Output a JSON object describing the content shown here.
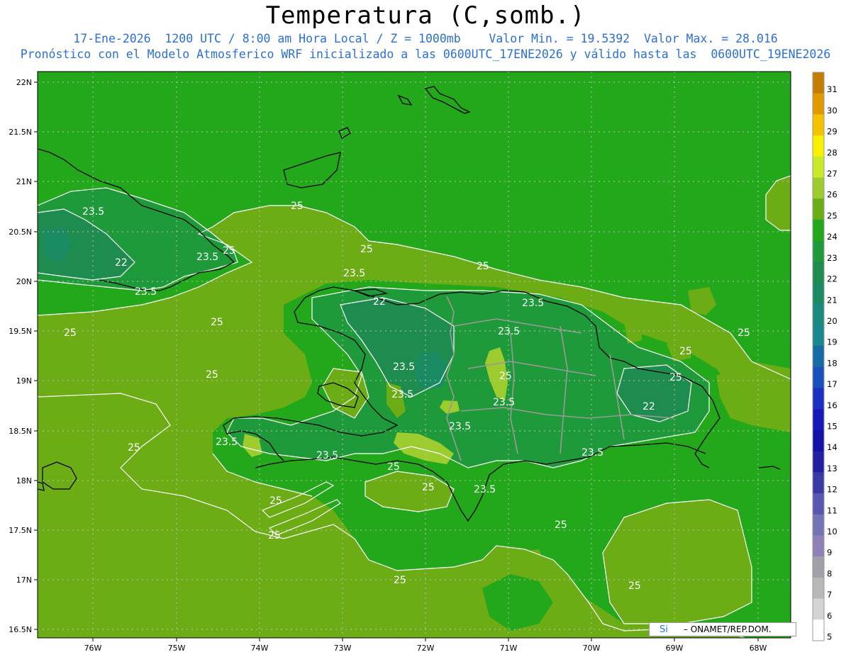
{
  "title": "Temperatura (C,somb.)",
  "subtitle_line1": "17-Ene-2026  1200 UTC / 8:00 am Hora Local / Z = 1000mb    Valor Min. = 19.5392  Valor Max. = 28.016",
  "subtitle_line2": "Pronóstico con el Modelo Atmosferico WRF inicializado a las 0600UTC_17ENE2026 y válido hasta las  0600UTC_19ENE2026",
  "lat_labels": [
    "22N",
    "21.5N",
    "21N",
    "20.5N",
    "20N",
    "19.5N",
    "19N",
    "18.5N",
    "18N",
    "17.5N",
    "17N",
    "16.5N"
  ],
  "lon_labels": [
    "76W",
    "75W",
    "74W",
    "73W",
    "72W",
    "71W",
    "70W",
    "69W",
    "68W"
  ],
  "colorbar": {
    "levels": [
      "31",
      "30",
      "29",
      "28",
      "27",
      "26",
      "25",
      "24",
      "23",
      "22",
      "21",
      "20",
      "19",
      "18",
      "17",
      "16",
      "15",
      "14",
      "13",
      "12",
      "11",
      "10",
      "9",
      "8",
      "7",
      "6",
      "5"
    ],
    "colors": [
      "#c47d00",
      "#e09a00",
      "#f5c200",
      "#f7f000",
      "#c8ea2a",
      "#9ccc2e",
      "#6cad15",
      "#22a81a",
      "#1f9a3a",
      "#1d8c4e",
      "#1a8a62",
      "#188a80",
      "#17888f",
      "#166aa6",
      "#1a50bb",
      "#1a30c2",
      "#1818b8",
      "#1212a8",
      "#2020a0",
      "#3a3aa6",
      "#5858b0",
      "#7474b4",
      "#9080b8",
      "#a0a0a8",
      "#b8b8b8",
      "#d4d4d4",
      "#ffffff"
    ]
  },
  "colors": {
    "sea": "#6cad15",
    "land_24": "#22a81a",
    "land_23": "#1f9a3a",
    "land_22": "#1d8c4e",
    "land_warm": "#9ccc2e",
    "highland_cold": "#1a8a62"
  },
  "contour_labels": [
    {
      "text": "25"
    },
    {
      "text": "25"
    },
    {
      "text": "25"
    },
    {
      "text": "25"
    },
    {
      "text": "25"
    },
    {
      "text": "25"
    },
    {
      "text": "25"
    },
    {
      "text": "25"
    },
    {
      "text": "25"
    },
    {
      "text": "25"
    },
    {
      "text": "25"
    },
    {
      "text": "25"
    },
    {
      "text": "25"
    },
    {
      "text": "25"
    },
    {
      "text": "25"
    },
    {
      "text": "25"
    },
    {
      "text": "25"
    },
    {
      "text": "25"
    },
    {
      "text": "25"
    },
    {
      "text": "23.5"
    },
    {
      "text": "23.5"
    },
    {
      "text": "23.5"
    },
    {
      "text": "23.5"
    },
    {
      "text": "23.5"
    },
    {
      "text": "23.5"
    },
    {
      "text": "23.5"
    },
    {
      "text": "23.5"
    },
    {
      "text": "23.5"
    },
    {
      "text": "23.5"
    },
    {
      "text": "23.5"
    },
    {
      "text": "23.5"
    },
    {
      "text": "23.5"
    },
    {
      "text": "23.5"
    },
    {
      "text": "22"
    },
    {
      "text": "22"
    },
    {
      "text": "22"
    }
  ],
  "credit": {
    "symbol": "Si",
    "org": "ONAMET/REP.DOM."
  }
}
